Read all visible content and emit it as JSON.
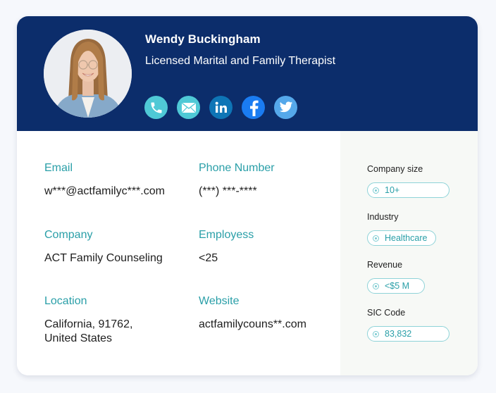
{
  "profile": {
    "name": "Wendy Buckingham",
    "job_title": "Licensed Marital and Family Therapist",
    "avatar_alt": "Profile photo of smiling woman with long hair and glasses"
  },
  "socials": [
    {
      "icon": "phone-icon",
      "color": "#4fc9d6"
    },
    {
      "icon": "email-icon",
      "color": "#4fc9d6"
    },
    {
      "icon": "linkedin-icon",
      "color": "#0e75b6"
    },
    {
      "icon": "facebook-icon",
      "color": "#1a7cf2"
    },
    {
      "icon": "twitter-icon",
      "color": "#55a8ea"
    }
  ],
  "fields": {
    "email": {
      "label": "Email",
      "value": "w***@actfamilyc***.com"
    },
    "phone": {
      "label": "Phone Number",
      "value": "(***) ***-****"
    },
    "company": {
      "label": "Company",
      "value": "ACT Family Counseling"
    },
    "employees": {
      "label": "Employess",
      "value": "<25"
    },
    "location": {
      "label": "Location",
      "value": "California, 91762,\nUnited States"
    },
    "website": {
      "label": "Website",
      "value": "actfamilycouns**.com"
    }
  },
  "sidebar": {
    "company_size": {
      "label": "Company size",
      "value": "10+"
    },
    "industry": {
      "label": "Industry",
      "value": "Healthcare"
    },
    "revenue": {
      "label": "Revenue",
      "value": "<$5 M"
    },
    "sic_code": {
      "label": "SIC Code",
      "value": "83,832"
    }
  },
  "colors": {
    "header_bg": "#0c2d6b",
    "accent_teal": "#2a9fa8",
    "pill_border": "#8fd3d8",
    "sidebar_bg": "#f7f9f6"
  }
}
